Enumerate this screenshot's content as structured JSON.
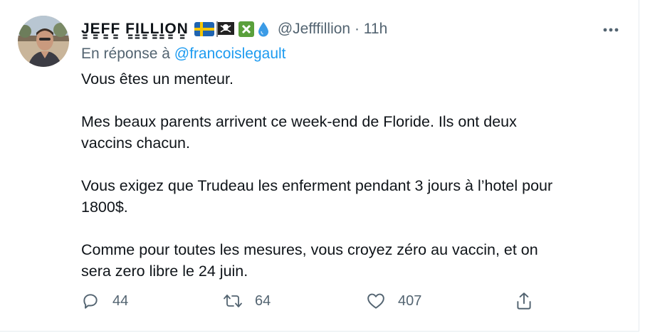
{
  "tweet": {
    "author": {
      "display_name": "J̳E̳F̳F̳ F̳I̳L̳L̳I̳O̳N̳",
      "handle": "@Jefffillion",
      "avatar_icon": "profile-photo",
      "badges": [
        "swedish-flag-icon",
        "pirate-flag-icon",
        "cross-mark-icon",
        "droplet-icon"
      ]
    },
    "separator": "·",
    "time": "11h",
    "reply_prefix": "En réponse à",
    "reply_mention": "@francoislegault",
    "paragraphs": [
      [
        "Vous êtes un menteur."
      ],
      [
        "Mes beaux parents arrivent ce week-end de Floride. Ils ont deux",
        "vaccins chacun."
      ],
      [
        "Vous exigez que Trudeau les enferment pendant 3 jours à l’hotel pour",
        "1800$."
      ],
      [
        "Comme pour toutes les mesures, vous croyez zéro au vaccin, et on",
        "sera zero  libre le 24 juin."
      ]
    ],
    "actions": {
      "reply_count": "44",
      "retweet_count": "64",
      "like_count": "407"
    },
    "colors": {
      "text": "#0f1419",
      "secondary": "#536471",
      "link": "#1d9bf0"
    }
  }
}
